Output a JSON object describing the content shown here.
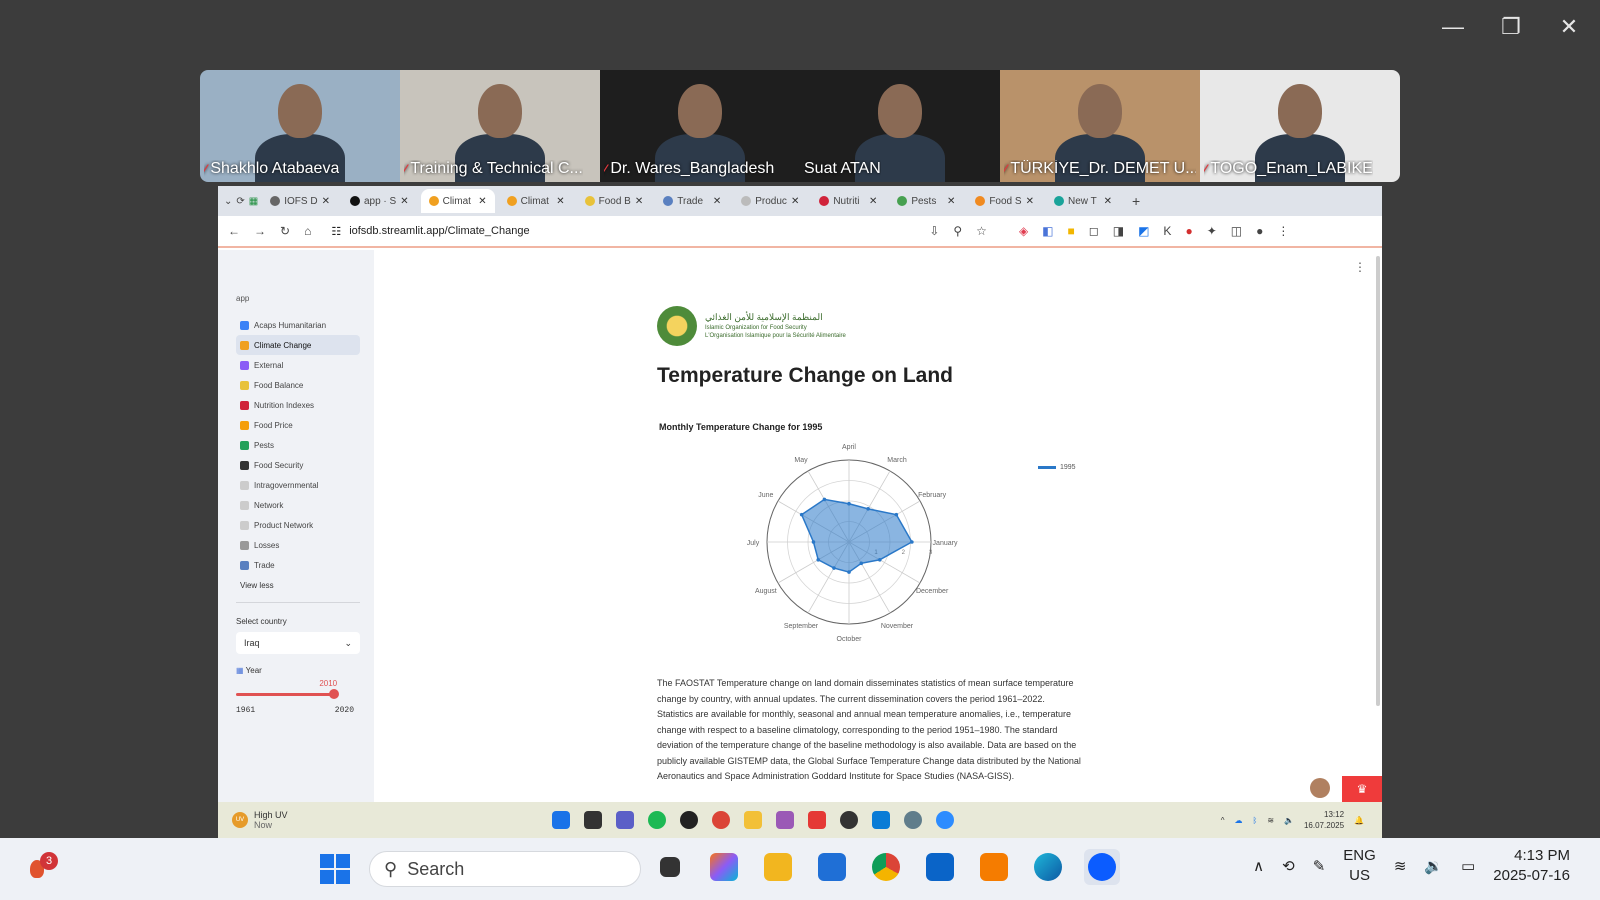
{
  "zoom": {
    "participants": [
      {
        "name": "Shakhlo Atabaeva",
        "muted": true,
        "bg": "#9ab0c4"
      },
      {
        "name": "Training & Technical C...",
        "muted": true,
        "bg": "#c8c4bc"
      },
      {
        "name": "Dr. Wares_Bangladesh",
        "muted": true,
        "bg": "#1e1e1e"
      },
      {
        "name": "Suat ATAN",
        "muted": false,
        "bg": "#1e1e1e",
        "active": true
      },
      {
        "name": "TÜRKİYE_Dr. DEMET U...",
        "muted": true,
        "bg": "#b9926a"
      },
      {
        "name": "TOGO_Enam_LABIKE",
        "muted": true,
        "bg": "#e8e8e8"
      }
    ]
  },
  "browser": {
    "tabs": [
      {
        "label": "IOFS D",
        "color": "#666"
      },
      {
        "label": "app · S",
        "color": "#111"
      },
      {
        "label": "Climat",
        "color": "#f0a020",
        "active": true
      },
      {
        "label": "Climat",
        "color": "#f0a020"
      },
      {
        "label": "Food B",
        "color": "#e8c23a"
      },
      {
        "label": "Trade",
        "color": "#5a80c0"
      },
      {
        "label": "Produc",
        "color": "#bbb"
      },
      {
        "label": "Nutriti",
        "color": "#d0233a"
      },
      {
        "label": "Pests",
        "color": "#46a050"
      },
      {
        "label": "Food S",
        "color": "#f08a20"
      },
      {
        "label": "New T",
        "color": "#1aa39a"
      }
    ],
    "url": "iofsdb.streamlit.app/Climate_Change"
  },
  "sidebar": {
    "app_label": "app",
    "items": [
      {
        "label": "Acaps Humanitarian",
        "color": "#3b82f6"
      },
      {
        "label": "Climate Change",
        "color": "#f0a020",
        "active": true
      },
      {
        "label": "External",
        "color": "#8b5cf6"
      },
      {
        "label": "Food Balance",
        "color": "#e8c23a"
      },
      {
        "label": "Nutrition Indexes",
        "color": "#d0233a"
      },
      {
        "label": "Food Price",
        "color": "#f59e0b"
      },
      {
        "label": "Pests",
        "color": "#22a05a"
      },
      {
        "label": "Food Security",
        "color": "#333"
      },
      {
        "label": "Intragovernmental",
        "color": "#ccc"
      },
      {
        "label": "Network",
        "color": "#ccc"
      },
      {
        "label": "Product Network",
        "color": "#ccc"
      },
      {
        "label": "Losses",
        "color": "#999"
      },
      {
        "label": "Trade",
        "color": "#5a80c0"
      }
    ],
    "view_less": "View less",
    "country_label": "Select country",
    "country_value": "Iraq",
    "year_label": "Year",
    "year_value": "2010",
    "year_min": "1961",
    "year_max": "2020",
    "year_fraction": 0.84
  },
  "content": {
    "org_arabic": "المنظمة الإسلامية للأمن الغذائي",
    "org_en": "Islamic Organization for Food Security",
    "org_fr": "L'Organisation Islamique pour la Sécurité Alimentaire",
    "title": "Temperature Change on Land",
    "chart_title": "Monthly Temperature Change for 1995",
    "description": "The FAOSTAT Temperature change on land domain disseminates statistics of mean surface temperature change by country, with annual updates. The current dissemination covers the period 1961–2022. Statistics are available for monthly, seasonal and annual mean temperature anomalies, i.e., temperature change with respect to a baseline climatology, corresponding to the period 1951–1980. The standard deviation of the temperature change of the baseline methodology is also available. Data are based on the publicly available GISTEMP data, the Global Surface Temperature Change data distributed by the National Aeronautics and Space Administration Goddard Institute for Space Studies (NASA-GISS)."
  },
  "chart_data": {
    "type": "radar",
    "categories": [
      "January",
      "February",
      "March",
      "April",
      "May",
      "June",
      "July",
      "August",
      "September",
      "October",
      "November",
      "December"
    ],
    "series": [
      {
        "name": "1995",
        "values": [
          2.3,
          2.0,
          1.4,
          1.4,
          1.8,
          2.0,
          1.3,
          1.3,
          1.1,
          1.1,
          0.9,
          1.3
        ]
      }
    ],
    "radial_ticks": [
      1,
      2,
      3
    ],
    "rmax": 3,
    "color": "#2a78c8"
  },
  "inner_taskbar": {
    "weather_title": "High UV",
    "weather_sub": "Now",
    "time": "13:12",
    "date": "16.07.2025"
  },
  "taskbar": {
    "notification_count": "3",
    "search_placeholder": "Search",
    "lang_top": "ENG",
    "lang_bottom": "US",
    "time": "4:13 PM",
    "date": "2025-07-16"
  }
}
